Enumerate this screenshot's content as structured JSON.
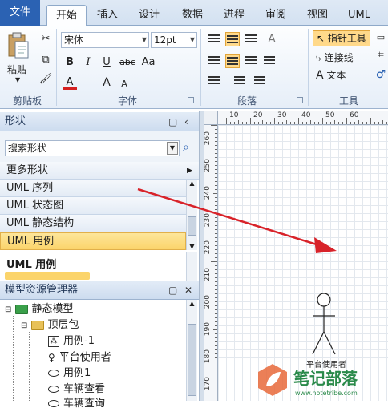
{
  "tabs": [
    "文件",
    "开始",
    "插入",
    "设计",
    "数据",
    "进程",
    "审阅",
    "视图",
    "UML"
  ],
  "clipboard": {
    "paste_label": "粘贴",
    "group_label": "剪贴板"
  },
  "font": {
    "name": "宋体",
    "size": "12pt",
    "group_label": "字体",
    "bold": "B",
    "italic": "I",
    "underline": "U",
    "strike": "abc",
    "case": "Aa",
    "color": "A",
    "grow": "A",
    "shrink": "A"
  },
  "paragraph": {
    "group_label": "段落"
  },
  "tools": {
    "pointer": "指针工具",
    "connector": "连接线",
    "text": "文本",
    "group_label": "工具"
  },
  "shapes_pane": {
    "title": "形状",
    "search_placeholder": "搜索形状",
    "more": "更多形状",
    "stencils": [
      "UML 序列",
      "UML 状态图",
      "UML 静态结构",
      "UML 用例"
    ],
    "selected_stencil": "UML 用例",
    "section_header": "UML 用例"
  },
  "model_explorer": {
    "title": "模型资源管理器",
    "tree": [
      "静态模型",
      "顶层包",
      "用例-1",
      "平台使用者",
      "用例1",
      "车辆查看",
      "车辆查询"
    ]
  },
  "ruler": {
    "h": [
      "10",
      "20",
      "30",
      "40",
      "50",
      "60"
    ],
    "v": [
      "260",
      "250",
      "240",
      "230",
      "220",
      "210",
      "200",
      "190",
      "180",
      "170"
    ]
  },
  "canvas": {
    "actor_label": "平台使用者"
  },
  "watermark": {
    "text": "笔记部落",
    "url": "www.notetribe.com"
  },
  "colors": {
    "arrow": "#d8232a",
    "file_tab": "#2b62b3",
    "highlight": "#fbd46b"
  }
}
